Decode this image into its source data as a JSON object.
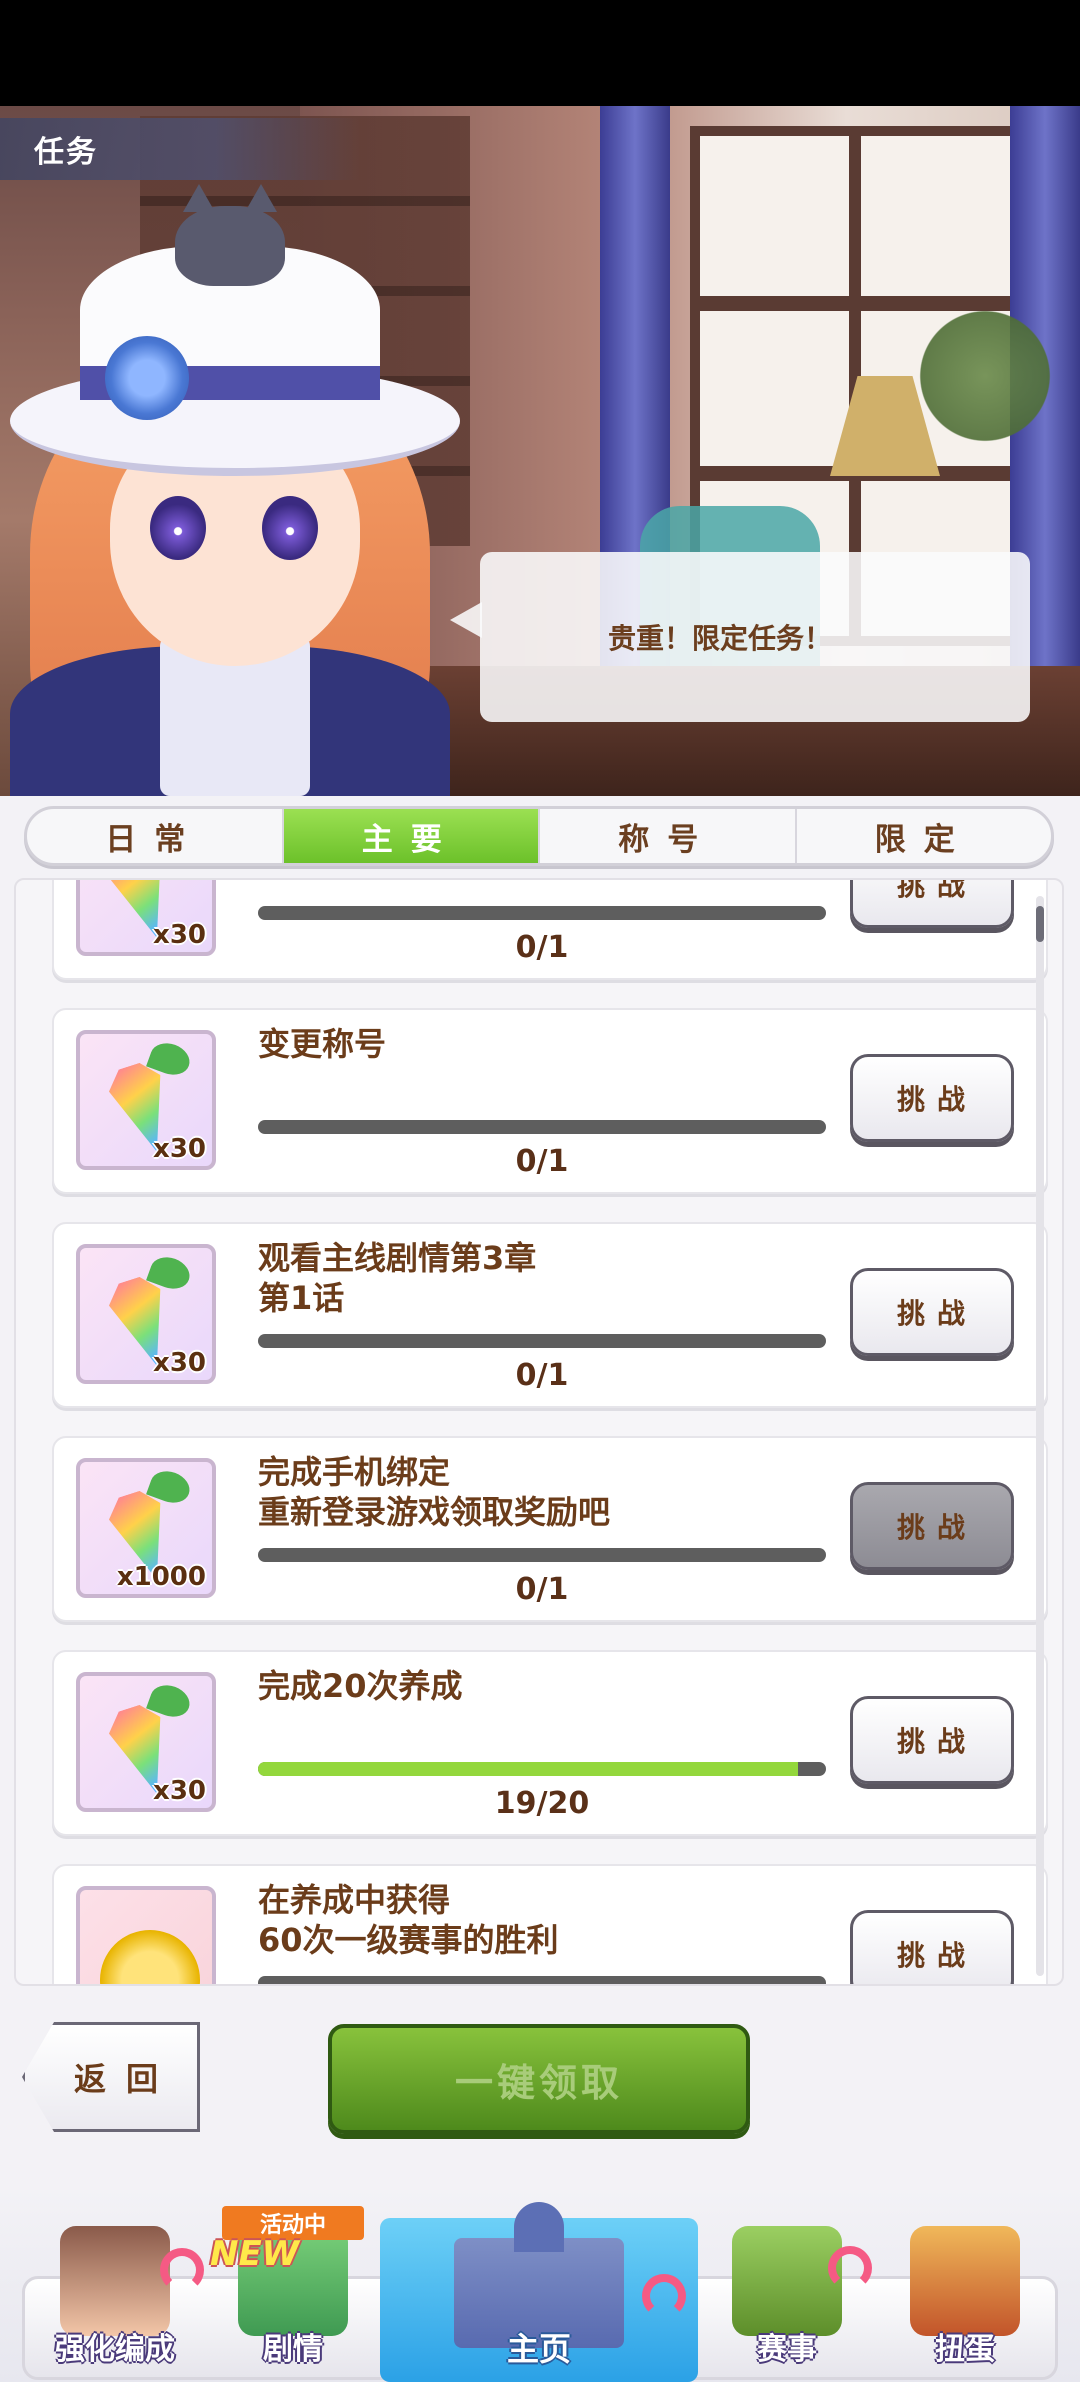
{
  "header": {
    "title": "任务"
  },
  "speech": {
    "text": "贵重！限定任务！"
  },
  "tabs": [
    {
      "label": "日常",
      "active": false
    },
    {
      "label": "主要",
      "active": true
    },
    {
      "label": "称号",
      "active": false
    },
    {
      "label": "限定",
      "active": false
    }
  ],
  "missions": [
    {
      "title": "",
      "reward_qty": "x30",
      "reward_icon": "rainbow-carrot-icon",
      "progress_text": "0/1",
      "progress": 0.0,
      "button": "挑战"
    },
    {
      "title": "变更称号",
      "reward_qty": "x30",
      "reward_icon": "rainbow-carrot-icon",
      "progress_text": "0/1",
      "progress": 0.0,
      "button": "挑战"
    },
    {
      "title": "观看主线剧情第3章\n第1话",
      "reward_qty": "x30",
      "reward_icon": "rainbow-carrot-icon",
      "progress_text": "0/1",
      "progress": 0.0,
      "button": "挑战"
    },
    {
      "title": "完成手机绑定\n重新登录游戏领取奖励吧",
      "reward_qty": "x1000",
      "reward_icon": "rainbow-carrot-icon",
      "progress_text": "0/1",
      "progress": 0.0,
      "button": "挑战"
    },
    {
      "title": "完成20次养成",
      "reward_qty": "x30",
      "reward_icon": "rainbow-carrot-icon",
      "progress_text": "19/20",
      "progress": 0.95,
      "button": "挑战"
    },
    {
      "title": "在养成中获得\n60次一级赛事的胜利",
      "reward_qty": "",
      "reward_icon": "gold-coin-icon",
      "progress_text": "",
      "progress": 0.0,
      "button": "挑战"
    }
  ],
  "actions": {
    "back": "返回",
    "claim_all": "一键领取"
  },
  "nav": {
    "items": [
      {
        "label": "强化编成"
      },
      {
        "label": "剧情",
        "event_tag": "活动中",
        "new_tag": "NEW"
      },
      {
        "label": "主页"
      },
      {
        "label": "赛事"
      },
      {
        "label": "扭蛋"
      }
    ]
  },
  "colors": {
    "tab_active": "#7fcd36",
    "progress_fill": "#93d73c",
    "progress_track": "#5e5e5e",
    "text_brown": "#6b3c1a",
    "claim_green": "#5e9a24"
  }
}
